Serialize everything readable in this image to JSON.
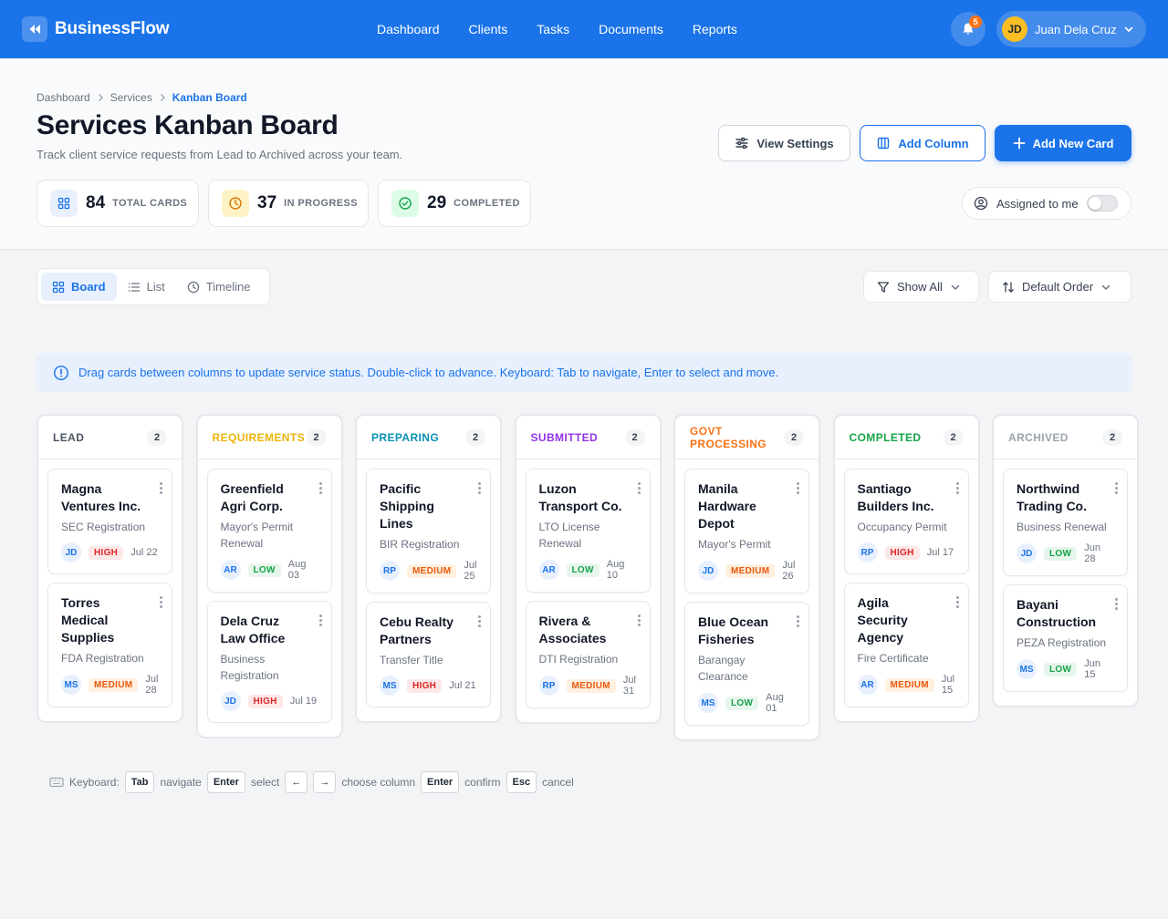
{
  "app": {
    "name": "BusinessFlow",
    "logo_icon": "rewind-icon"
  },
  "nav": {
    "items": [
      "Dashboard",
      "Clients",
      "Tasks",
      "Documents",
      "Reports"
    ]
  },
  "notifications": {
    "count": "5"
  },
  "user": {
    "initials": "JD",
    "name": "Juan Dela Cruz"
  },
  "breadcrumb": [
    "Dashboard",
    "Services",
    "Kanban Board"
  ],
  "page": {
    "title": "Services Kanban Board",
    "subtitle": "Track client service requests from Lead to Archived across your team."
  },
  "actions": {
    "view_settings": "View Settings",
    "add_column": "Add Column",
    "add_card": "Add New Card"
  },
  "stats": [
    {
      "value": "84",
      "label": "TOTAL CARDS",
      "color": "#1a73e8"
    },
    {
      "value": "37",
      "label": "IN PROGRESS",
      "color": "#d97706"
    },
    {
      "value": "29",
      "label": "COMPLETED",
      "color": "#16a34a"
    }
  ],
  "assigned": {
    "label": "Assigned to me",
    "on": false
  },
  "views": {
    "tabs": [
      "Board",
      "List",
      "Timeline"
    ],
    "active": "Board"
  },
  "filters": {
    "show": "Show All",
    "order": "Default Order"
  },
  "hint": "Drag cards between columns to update service status. Double-click to advance. Keyboard: Tab to navigate, Enter to select and move.",
  "columns": [
    {
      "title": "LEAD",
      "count": "2",
      "color": "#4b5563",
      "cards": [
        {
          "title": "Magna Ventures Inc.",
          "service": "SEC Registration",
          "assignee": "JD",
          "priority": "HIGH",
          "date": "Jul 22"
        },
        {
          "title": "Torres Medical Supplies",
          "service": "FDA Registration",
          "assignee": "MS",
          "priority": "MEDIUM",
          "date": "Jul 28"
        }
      ]
    },
    {
      "title": "REQUIREMENTS",
      "count": "2",
      "color": "#eab308",
      "cards": [
        {
          "title": "Greenfield Agri Corp.",
          "service": "Mayor's Permit Renewal",
          "assignee": "AR",
          "priority": "LOW",
          "date": "Aug 03"
        },
        {
          "title": "Dela Cruz Law Office",
          "service": "Business Registration",
          "assignee": "JD",
          "priority": "HIGH",
          "date": "Jul 19"
        }
      ]
    },
    {
      "title": "PREPARING",
      "count": "2",
      "color": "#0891b2",
      "cards": [
        {
          "title": "Pacific Shipping Lines",
          "service": "BIR Registration",
          "assignee": "RP",
          "priority": "MEDIUM",
          "date": "Jul 25"
        },
        {
          "title": "Cebu Realty Partners",
          "service": "Transfer Title",
          "assignee": "MS",
          "priority": "HIGH",
          "date": "Jul 21"
        }
      ]
    },
    {
      "title": "SUBMITTED",
      "count": "2",
      "color": "#9333ea",
      "cards": [
        {
          "title": "Luzon Transport Co.",
          "service": "LTO License Renewal",
          "assignee": "AR",
          "priority": "LOW",
          "date": "Aug 10"
        },
        {
          "title": "Rivera & Associates",
          "service": "DTI Registration",
          "assignee": "RP",
          "priority": "MEDIUM",
          "date": "Jul 31"
        }
      ]
    },
    {
      "title": "GOVT PROCESSING",
      "count": "2",
      "color": "#f97316",
      "cards": [
        {
          "title": "Manila Hardware Depot",
          "service": "Mayor's Permit",
          "assignee": "JD",
          "priority": "MEDIUM",
          "date": "Jul 26"
        },
        {
          "title": "Blue Ocean Fisheries",
          "service": "Barangay Clearance",
          "assignee": "MS",
          "priority": "LOW",
          "date": "Aug 01"
        }
      ]
    },
    {
      "title": "COMPLETED",
      "count": "2",
      "color": "#16a34a",
      "cards": [
        {
          "title": "Santiago Builders Inc.",
          "service": "Occupancy Permit",
          "assignee": "RP",
          "priority": "HIGH",
          "date": "Jul 17"
        },
        {
          "title": "Agila Security Agency",
          "service": "Fire Certificate",
          "assignee": "AR",
          "priority": "MEDIUM",
          "date": "Jul 15"
        }
      ]
    },
    {
      "title": "ARCHIVED",
      "count": "2",
      "color": "#9ca3af",
      "cards": [
        {
          "title": "Northwind Trading Co.",
          "service": "Business Renewal",
          "assignee": "JD",
          "priority": "LOW",
          "date": "Jun 28"
        },
        {
          "title": "Bayani Construction",
          "service": "PEZA Registration",
          "assignee": "MS",
          "priority": "LOW",
          "date": "Jun 15"
        }
      ]
    }
  ],
  "keyboard": {
    "label": "Keyboard:",
    "tab_key": "Tab",
    "tab_action": "navigate",
    "enter_key": "Enter",
    "enter_action": "select",
    "left_key": "←",
    "right_key": "→",
    "arrow_action": "choose column",
    "confirm_key": "Enter",
    "confirm_action": "confirm",
    "esc_key": "Esc",
    "esc_action": "cancel"
  }
}
